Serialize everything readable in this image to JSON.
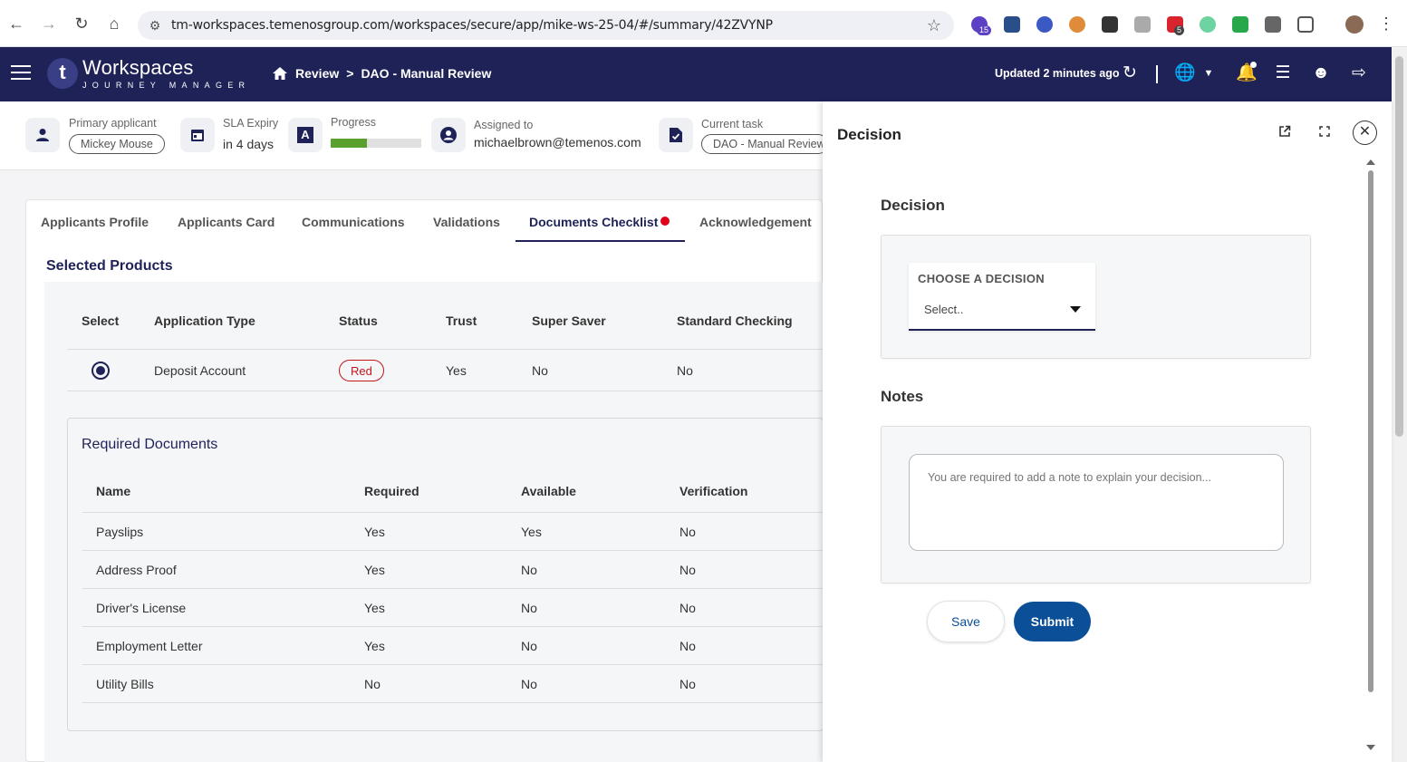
{
  "browser": {
    "url": "tm-workspaces.temenosgroup.com/workspaces/secure/app/mike-ws-25-04/#/summary/42ZVYNP",
    "extensions_badges": [
      "15",
      "5"
    ]
  },
  "header": {
    "logo_letter": "t",
    "app_title": "Workspaces",
    "app_subtitle": "JOURNEY MANAGER",
    "breadcrumb": [
      "Review",
      "DAO - Manual Review"
    ],
    "breadcrumb_sep": ">",
    "updated": "Updated 2 minutes ago"
  },
  "summary": {
    "primary_applicant_label": "Primary applicant",
    "primary_applicant": "Mickey Mouse",
    "sla_label": "SLA Expiry",
    "sla_value": "in 4 days",
    "progress_label": "Progress",
    "progress_fraction": 0.4,
    "assigned_label": "Assigned to",
    "assigned_value": "michaelbrown@temenos.com",
    "task_label": "Current task",
    "task_value": "DAO - Manual Review",
    "task_letter": "A"
  },
  "tabs": [
    "Applicants Profile",
    "Applicants Card",
    "Communications",
    "Validations",
    "Documents Checklist",
    "Acknowledgement"
  ],
  "selected_products": {
    "title": "Selected Products",
    "columns": [
      "Select",
      "Application Type",
      "Status",
      "Trust",
      "Super Saver",
      "Standard Checking"
    ],
    "row": {
      "application_type": "Deposit Account",
      "status": "Red",
      "trust": "Yes",
      "super_saver": "No",
      "standard_checking": "No"
    }
  },
  "required_documents": {
    "title": "Required Documents",
    "columns": [
      "Name",
      "Required",
      "Available",
      "Verification"
    ],
    "rows": [
      [
        "Payslips",
        "Yes",
        "Yes",
        "No"
      ],
      [
        "Address Proof",
        "Yes",
        "No",
        "No"
      ],
      [
        "Driver's License",
        "Yes",
        "No",
        "No"
      ],
      [
        "Employment Letter",
        "Yes",
        "No",
        "No"
      ],
      [
        "Utility Bills",
        "No",
        "No",
        "No"
      ]
    ]
  },
  "drawer": {
    "title": "Decision",
    "decision_section": "Decision",
    "choose_label": "CHOOSE A DECISION",
    "select_value": "Select..",
    "notes_section": "Notes",
    "notes_placeholder": "You are required to add a note to explain your decision...",
    "save": "Save",
    "submit": "Submit"
  },
  "colors": {
    "header_bg": "#1e2257",
    "accent": "#0a4f97",
    "status_red": "#c0161d",
    "progress": "#5aa02c",
    "tab_dot": "#e0001b"
  }
}
